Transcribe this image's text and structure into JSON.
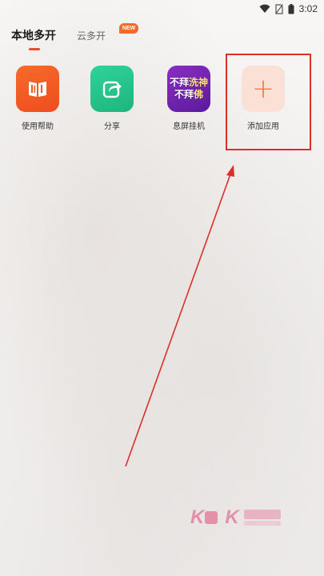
{
  "status_bar": {
    "time": "3:02",
    "icons": [
      "wifi-icon",
      "no-sim-icon",
      "battery-icon"
    ]
  },
  "tabs": {
    "local": "本地多开",
    "cloud": "云多开",
    "cloud_badge": "NEW"
  },
  "apps": [
    {
      "label": "使用帮助",
      "icon": "book-icon",
      "color": "#f3562a"
    },
    {
      "label": "分享",
      "icon": "share-icon",
      "color": "#25c489"
    },
    {
      "label": "息屏挂机",
      "icon": "screen-off-idle-icon",
      "color": "#7424b1",
      "icon_text": [
        "不拜",
        "洗",
        "神",
        "不拜",
        "佛"
      ]
    },
    {
      "label": "添加应用",
      "icon": "plus-icon",
      "icon_glyph": "+",
      "color": "#fbe0d6"
    }
  ],
  "colors": {
    "accent": "#e8502c",
    "annotation": "#d9302c"
  }
}
